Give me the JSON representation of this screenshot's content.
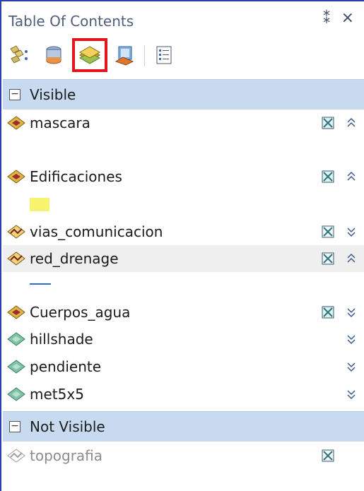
{
  "panel": {
    "title": "Table Of Contents",
    "pin_glyph": "⁑",
    "close_glyph": "×"
  },
  "toolbar": {
    "buttons": [
      {
        "name": "list-by-drawing-order-icon",
        "selected": false
      },
      {
        "name": "list-by-source-icon",
        "selected": false
      },
      {
        "name": "list-by-visibility-icon",
        "selected": true
      },
      {
        "name": "list-by-selection-icon",
        "selected": false
      },
      {
        "name": "options-icon",
        "selected": false
      }
    ]
  },
  "groups": [
    {
      "label": "Visible",
      "toggle": "−",
      "layers": [
        {
          "name": "mascara",
          "type": "polygon",
          "checked": true,
          "expand": "up"
        },
        {
          "name": "Edificaciones",
          "type": "polygon",
          "checked": true,
          "expand": "up"
        },
        {
          "name": "vias_comunicacion",
          "type": "line",
          "checked": true,
          "expand": "down"
        },
        {
          "name": "red_drenage",
          "type": "line",
          "checked": true,
          "expand": "up"
        },
        {
          "name": "Cuerpos_agua",
          "type": "polygon",
          "checked": true,
          "expand": "down"
        },
        {
          "name": "hillshade",
          "type": "raster",
          "checked": false,
          "expand": "down"
        },
        {
          "name": "pendiente",
          "type": "raster",
          "checked": false,
          "expand": "down"
        },
        {
          "name": "met5x5",
          "type": "raster",
          "checked": false,
          "expand": "down"
        }
      ]
    },
    {
      "label": "Not Visible",
      "toggle": "−",
      "layers": [
        {
          "name": "topografia",
          "type": "line-dim",
          "checked": true,
          "expand": ""
        }
      ]
    }
  ],
  "colors": {
    "frame": "#2b3fae",
    "header_bg": "#c8daf0",
    "selection_outline": "#e3141b",
    "edificaciones_swatch": "#f8f36e",
    "red_drenage_line": "#2e6dd1"
  }
}
